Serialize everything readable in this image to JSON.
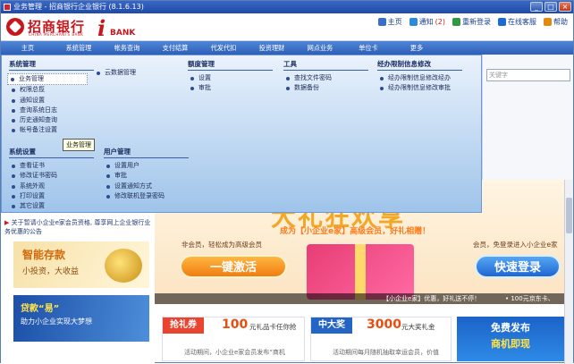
{
  "window": {
    "title": "业务管理 - 招商银行企业银行 (8.1.6.13)"
  },
  "header": {
    "logo_cn": "招商银行",
    "logo_en": "CHINA MERCHANTS BANK",
    "ibank_i": "i",
    "ibank_text": "BANK",
    "links": [
      {
        "label": "主页",
        "icon": "home-icon",
        "color": "#3a6fc6"
      },
      {
        "label": "通知",
        "icon": "bell-icon",
        "color": "#2c8ad8",
        "count": "(2)"
      },
      {
        "label": "重新登录",
        "icon": "relogin-icon",
        "color": "#2f9a42"
      },
      {
        "label": "在线客服",
        "icon": "service-icon",
        "color": "#1b6ad0"
      },
      {
        "label": "帮助",
        "icon": "help-icon",
        "color": "#e08a12"
      }
    ]
  },
  "nav": [
    "主页",
    "系统管理",
    "帐务查询",
    "支付结算",
    "代发代扣",
    "投资理财",
    "网点业务",
    "单位卡",
    "更多"
  ],
  "menu": {
    "system": {
      "title": "系统管理",
      "items": [
        "业务管理",
        "权限总揽",
        "通知设置",
        "查询系统日志",
        "历史通知查询",
        "帐号备注设置"
      ]
    },
    "system_extra": {
      "items": [
        "云数据管理"
      ]
    },
    "quota": {
      "title": "额度管理",
      "items": [
        "设置",
        "审批"
      ]
    },
    "tools": {
      "title": "工具",
      "items": [
        "查找文件密码",
        "数据备份"
      ]
    },
    "handling": {
      "title": "经办限制信息修改",
      "items": [
        "经办限制信息修改经办",
        "经办限制信息修改审批"
      ]
    },
    "settings": {
      "title": "系统设置",
      "items": [
        "查看证书",
        "修改证书密码",
        "系统外观",
        "打印设置",
        "其它设置"
      ]
    },
    "users": {
      "title": "用户管理",
      "items": [
        "设置用户",
        "审批",
        "设置通知方式",
        "修改联机登录密码"
      ]
    },
    "tooltip": "业务管理"
  },
  "search": {
    "placeholder": "关键字"
  },
  "notice": "关于暂请小企业e家会员资格, 尊享网上企业银行业务优惠的公告",
  "ads": {
    "left1": {
      "title": "智能存款",
      "subtitle": "小投资，大收益"
    },
    "left2": {
      "title": "贷款“易”",
      "subtitle": "助力小企业实现大梦想"
    }
  },
  "banner": {
    "title": "大礼狂欢享",
    "slogan": "成为【小企业e家】高级会员，好礼相赠！",
    "nonmember": "非会员，轻松成为高级会员",
    "member": "会员，免登录进入小企业e家",
    "activate": "一键激活",
    "login": "快速登录",
    "bar_a": "【小企业e家】优惠，好礼送不停！",
    "bar_b": "• 100元京东卡、"
  },
  "promos": [
    {
      "label": "抢礼券",
      "amount": "100",
      "unit": "元礼品卡任你抢",
      "desc": "活动期间，小企业e家会员发布“商机",
      "color": "#e8442f"
    },
    {
      "label": "中大奖",
      "amount": "3000",
      "unit": "元大奖礼金",
      "desc": "活动期间每月随机抽取幸运会员，价值",
      "color": "#2364c5"
    }
  ],
  "promo3": {
    "line1": "免费发布",
    "line2": "商机即现"
  }
}
